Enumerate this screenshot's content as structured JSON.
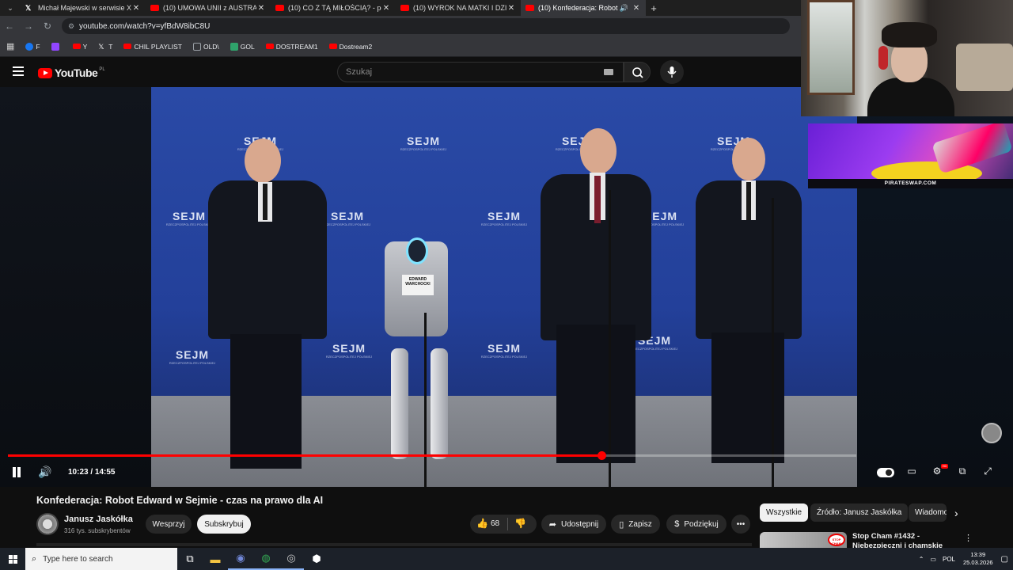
{
  "browser": {
    "tabs": [
      {
        "title": "Michał Majewski w serwisie X:",
        "icon": "x-icon",
        "active": false
      },
      {
        "title": "(10) UMOWA UNII z AUSTRALIĄ",
        "icon": "youtube-icon",
        "active": false
      },
      {
        "title": "(10) CO Z TĄ MIŁOŚCIĄ? - pole",
        "icon": "youtube-icon",
        "active": false
      },
      {
        "title": "(10) WYROK NA MATKI I DZIECI",
        "icon": "youtube-icon",
        "active": false
      },
      {
        "title": "(10) Konfederacja: Robot Ed",
        "icon": "youtube-icon",
        "active": true
      }
    ],
    "new_tab": "+",
    "url": "youtube.com/watch?v=yfBdW8ibC8U",
    "bookmarks": [
      {
        "label": "F",
        "icon": "facebook-icon",
        "color": "#1877f2"
      },
      {
        "label": "",
        "icon": "twitch-icon",
        "color": "#9146ff"
      },
      {
        "label": "Y",
        "icon": "youtube-icon",
        "color": "#ff0000"
      },
      {
        "label": "T",
        "icon": "x-icon",
        "color": "#000000"
      },
      {
        "label": "CHIL PLAYLIST",
        "icon": "youtube-icon",
        "color": "#ff0000"
      },
      {
        "label": "OLD\\",
        "icon": "folder-icon",
        "color": "#9aa0a6"
      },
      {
        "label": "GOL",
        "icon": "gol-icon",
        "color": "#2fa36b"
      },
      {
        "label": "DOSTREAM1",
        "icon": "youtube-icon",
        "color": "#ff0000"
      },
      {
        "label": "Dostream2",
        "icon": "youtube-icon",
        "color": "#ff0000"
      }
    ]
  },
  "youtube": {
    "logo_text": "YouTube",
    "logo_country": "PL",
    "search_placeholder": "Szukaj",
    "video": {
      "scene_text": {
        "sejm": "SEJM",
        "sejm_sub": "RZECZPOSPOLITEJ POLSKIEJ",
        "robot_label": "EDWARD WARCHOCKI"
      },
      "time": "10:23 / 14:55",
      "progress": 0.7
    },
    "title": "Konfederacja: Robot Edward w Sejmie - czas na prawo dla AI",
    "channel": {
      "name": "Janusz Jaskółka",
      "subscribers": "316 tys. subskrybentów"
    },
    "buttons": {
      "support": "Wesprzyj",
      "subscribe": "Subskrybuj",
      "likes": "68",
      "share": "Udostępnij",
      "save": "Zapisz",
      "thanks": "Podziękuj"
    },
    "chips": [
      "Wszystkie",
      "Źródło: Janusz Jaskółka",
      "Wiadomo"
    ],
    "recommended": {
      "title": "Stop Cham #1432 - Niebezpieczni i chamskie",
      "thumb_badge": "STOP CHAM"
    }
  },
  "overlay": {
    "ad_text": "PIRATESWAP.COM"
  },
  "taskbar": {
    "search_placeholder": "Type here to search",
    "language": "POL",
    "time": "13:39",
    "date": "25.03.2026"
  },
  "colors": {
    "accent_red": "#ff0000",
    "background": "#0f0f0f",
    "chip_active": "#f1f1f1"
  }
}
